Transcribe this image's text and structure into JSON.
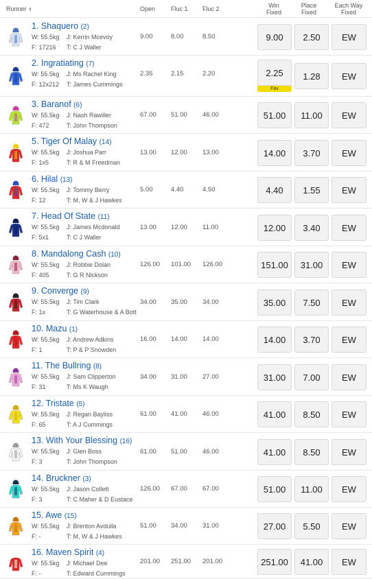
{
  "columns": {
    "runner": "Runner",
    "sort_glyph": "⬍",
    "open": "Open",
    "fluc1": "Fluc 1",
    "fluc2": "Fluc 2",
    "win_fixed": [
      "Win",
      "Fixed"
    ],
    "place_fixed": [
      "Place",
      "Fixed"
    ],
    "each_way_fixed": [
      "Each Way",
      "Fixed"
    ]
  },
  "fav_label": "Fav",
  "runners": [
    {
      "name": "1. Shaquero",
      "barrier": "(2)",
      "weight": "W: 55.5kg",
      "jockey": "J: Kerrin Mcevoy",
      "form": "F: 17216",
      "trainer": "T: C J Waller",
      "open": "9.00",
      "fluc1": "8.00",
      "fluc2": "8.50",
      "win": "9.00",
      "place": "2.50",
      "ew": "EW",
      "silk_icon": "jockey-silks-white-blue-icon",
      "silk_colors": [
        "#d7e4f7",
        "#4a72c0"
      ]
    },
    {
      "name": "2. Ingratiating",
      "barrier": "(7)",
      "weight": "W: 55.5kg",
      "jockey": "J: Ms Rachel King",
      "form": "F: 12x212",
      "trainer": "T: James Cummings",
      "open": "2.35",
      "fluc1": "2.15",
      "fluc2": "2.20",
      "win": "2.25",
      "place": "1.28",
      "ew": "EW",
      "fav": true,
      "silk_icon": "jockey-silks-royal-blue-icon",
      "silk_colors": [
        "#2f63d9",
        "#1d3f9a"
      ]
    },
    {
      "name": "3. Baranof",
      "barrier": "(6)",
      "weight": "W: 55.5kg",
      "jockey": "J: Nash Rawiller",
      "form": "F: 472",
      "trainer": "T: John Thompson",
      "open": "67.00",
      "fluc1": "51.00",
      "fluc2": "46.00",
      "win": "51.00",
      "place": "11.00",
      "ew": "EW",
      "silk_icon": "jockey-silks-lime-spots-icon",
      "silk_colors": [
        "#b6e62a",
        "#d0409a"
      ]
    },
    {
      "name": "5. Tiger Of Malay",
      "barrier": "(14)",
      "weight": "W: 55.5kg",
      "jockey": "J: Joshua Parr",
      "form": "F: 1x5",
      "trainer": "T: R & M Freedman",
      "open": "13.00",
      "fluc1": "12.00",
      "fluc2": "13.00",
      "win": "14.00",
      "place": "3.70",
      "ew": "EW",
      "silk_icon": "jockey-silks-red-yellow-spots-icon",
      "silk_colors": [
        "#e02a2a",
        "#f3d000"
      ]
    },
    {
      "name": "6. Hilal",
      "barrier": "(13)",
      "weight": "W: 55.5kg",
      "jockey": "J: Tommy Berry",
      "form": "F: 12",
      "trainer": "T: M, W & J Hawkes",
      "open": "5.00",
      "fluc1": "4.40",
      "fluc2": "4.50",
      "win": "4.40",
      "place": "1.55",
      "ew": "EW",
      "silk_icon": "jockey-silks-red-blue-icon",
      "silk_colors": [
        "#e02a2a",
        "#2950c8"
      ]
    },
    {
      "name": "7. Head Of State",
      "barrier": "(11)",
      "weight": "W: 55.5kg",
      "jockey": "J: James Mcdonald",
      "form": "F: 5x1",
      "trainer": "T: C J Waller",
      "open": "13.00",
      "fluc1": "12.00",
      "fluc2": "11.00",
      "win": "12.00",
      "place": "3.40",
      "ew": "EW",
      "silk_icon": "jockey-silks-navy-icon",
      "silk_colors": [
        "#1a2f86",
        "#0f1d5a"
      ]
    },
    {
      "name": "8. Mandalong Cash",
      "barrier": "(10)",
      "weight": "W: 55.5kg",
      "jockey": "J: Robbie Dolan",
      "form": "F: 405",
      "trainer": "T: G R Nickson",
      "open": "126.00",
      "fluc1": "101.00",
      "fluc2": "126.00",
      "win": "151.00",
      "place": "31.00",
      "ew": "EW",
      "silk_icon": "jockey-silks-pink-maroon-icon",
      "silk_colors": [
        "#f0b8c8",
        "#8a1f3c"
      ]
    },
    {
      "name": "9. Converge",
      "barrier": "(9)",
      "weight": "W: 55.5kg",
      "jockey": "J: Tim Clark",
      "form": "F: 1x",
      "trainer": "T: G Waterhouse & A Bott",
      "open": "34.00",
      "fluc1": "35.00",
      "fluc2": "34.00",
      "win": "35.00",
      "place": "7.50",
      "ew": "EW",
      "silk_icon": "jockey-silks-red-black-icon",
      "silk_colors": [
        "#c8202a",
        "#222222"
      ]
    },
    {
      "name": "10. Mazu",
      "barrier": "(1)",
      "weight": "W: 55.5kg",
      "jockey": "J: Andrew Adkins",
      "form": "F: 1",
      "trainer": "T: P & P Snowden",
      "open": "16.00",
      "fluc1": "14.00",
      "fluc2": "14.00",
      "win": "14.00",
      "place": "3.70",
      "ew": "EW",
      "silk_icon": "jockey-silks-red-icon",
      "silk_colors": [
        "#e02a2a",
        "#b01818"
      ]
    },
    {
      "name": "11. The Bullring",
      "barrier": "(8)",
      "weight": "W: 55.5kg",
      "jockey": "J: Sam Clipperton",
      "form": "F: 31",
      "trainer": "T: Ms K Waugh",
      "open": "34.00",
      "fluc1": "31.00",
      "fluc2": "27.00",
      "win": "31.00",
      "place": "7.00",
      "ew": "EW",
      "silk_icon": "jockey-silks-pink-spots-icon",
      "silk_colors": [
        "#f0a8d8",
        "#8a3aa0"
      ]
    },
    {
      "name": "12. Tristate",
      "barrier": "(5)",
      "weight": "W: 55.5kg",
      "jockey": "J: Regan Bayliss",
      "form": "F: 65",
      "trainer": "T: A J Cummings",
      "open": "61.00",
      "fluc1": "41.00",
      "fluc2": "46.00",
      "win": "41.00",
      "place": "8.50",
      "ew": "EW",
      "silk_icon": "jockey-silks-yellow-icon",
      "silk_colors": [
        "#f4e01a",
        "#d0a800"
      ]
    },
    {
      "name": "13. With Your Blessing",
      "barrier": "(16)",
      "weight": "W: 55.5kg",
      "jockey": "J: Glen Boss",
      "form": "F: 3",
      "trainer": "T: John Thompson",
      "open": "61.00",
      "fluc1": "51.00",
      "fluc2": "46.00",
      "win": "41.00",
      "place": "8.50",
      "ew": "EW",
      "silk_icon": "jockey-silks-white-grey-icon",
      "silk_colors": [
        "#f4f4f4",
        "#9a9a9a"
      ]
    },
    {
      "name": "14. Bruckner",
      "barrier": "(3)",
      "weight": "W: 55.5kg",
      "jockey": "J: Jason Collett",
      "form": "F: 3",
      "trainer": "T: C Maher & D Eustace",
      "open": "126.00",
      "fluc1": "67.00",
      "fluc2": "67.00",
      "win": "51.00",
      "place": "11.00",
      "ew": "EW",
      "silk_icon": "jockey-silks-turquoise-icon",
      "silk_colors": [
        "#2ad6d0",
        "#16324a"
      ]
    },
    {
      "name": "15. Awe",
      "barrier": "(15)",
      "weight": "W: 55.5kg",
      "jockey": "J: Brenton Avdulla",
      "form": "F: -",
      "trainer": "T: M, W & J Hawkes",
      "open": "51.00",
      "fluc1": "34.00",
      "fluc2": "31.00",
      "win": "27.00",
      "place": "5.50",
      "ew": "EW",
      "silk_icon": "jockey-silks-orange-icon",
      "silk_colors": [
        "#f2a21e",
        "#c87808"
      ]
    },
    {
      "name": "16. Maven Spirit",
      "barrier": "(4)",
      "weight": "W: 55.5kg",
      "jockey": "J: Michael Dee",
      "form": "F: -",
      "trainer": "T: Edward Cummings",
      "open": "201.00",
      "fluc1": "251.00",
      "fluc2": "201.00",
      "win": "251.00",
      "place": "41.00",
      "ew": "EW",
      "silk_icon": "jockey-silks-red-white-star-icon",
      "silk_colors": [
        "#e02a2a",
        "#ffffff"
      ]
    }
  ]
}
